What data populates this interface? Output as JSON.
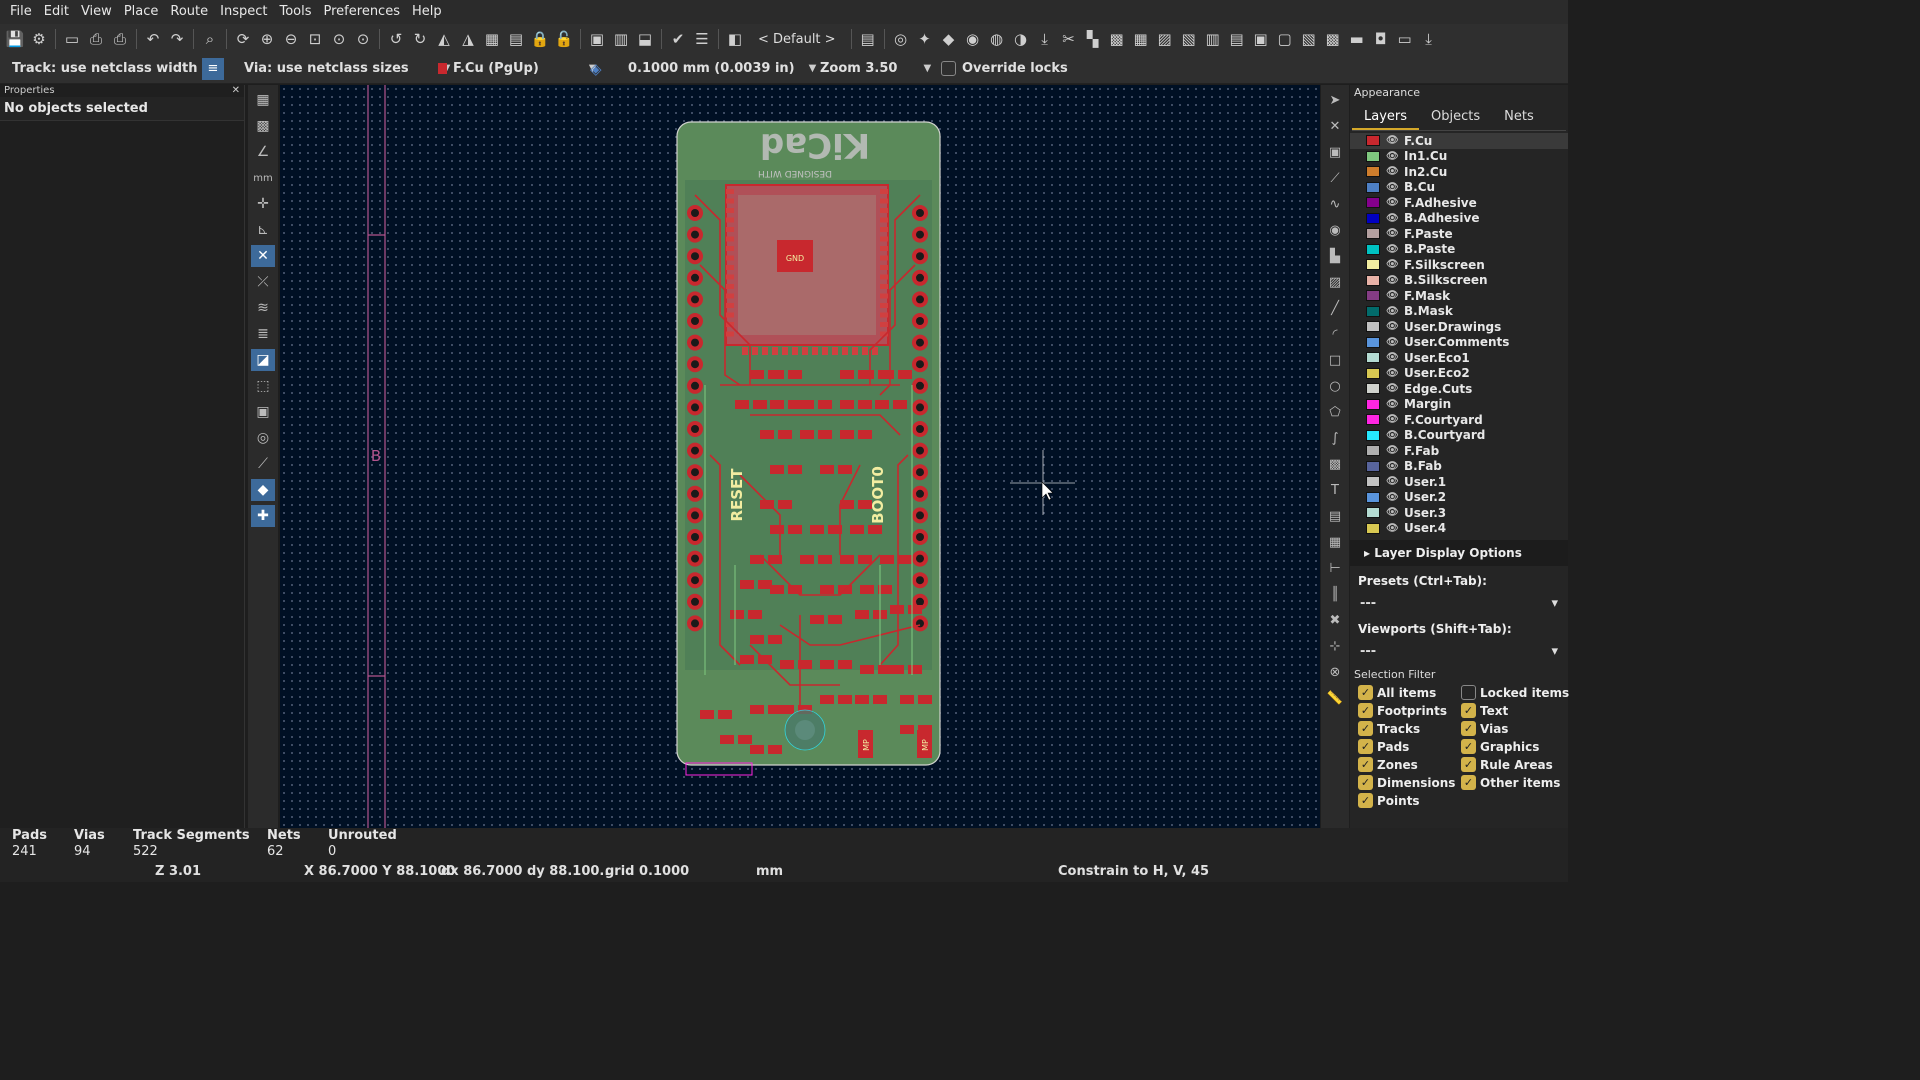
{
  "menu": [
    "File",
    "Edit",
    "View",
    "Place",
    "Route",
    "Inspect",
    "Tools",
    "Preferences",
    "Help"
  ],
  "toolbar": {
    "preset": "< Default >"
  },
  "options": {
    "track": "Track: use netclass width",
    "via": "Via: use netclass sizes",
    "layer": "F.Cu (PgUp)",
    "layer_color": "#c8282e",
    "grid": "0.1000 mm (0.0039 in)",
    "zoom": "Zoom 3.50",
    "override": "Override locks"
  },
  "properties": {
    "title": "Properties",
    "empty": "No objects selected"
  },
  "appearance": {
    "title": "Appearance",
    "tabs": [
      "Layers",
      "Objects",
      "Nets"
    ],
    "layers": [
      {
        "name": "F.Cu",
        "color": "#c8282e"
      },
      {
        "name": "In1.Cu",
        "color": "#7fc87f"
      },
      {
        "name": "In2.Cu",
        "color": "#ce7d2c"
      },
      {
        "name": "B.Cu",
        "color": "#4d7fc4"
      },
      {
        "name": "F.Adhesive",
        "color": "#84008c"
      },
      {
        "name": "B.Adhesive",
        "color": "#0000c0"
      },
      {
        "name": "F.Paste",
        "color": "#b4a0a0"
      },
      {
        "name": "B.Paste",
        "color": "#00c2c2"
      },
      {
        "name": "F.Silkscreen",
        "color": "#f2eda1"
      },
      {
        "name": "B.Silkscreen",
        "color": "#e8b2a7"
      },
      {
        "name": "F.Mask",
        "color": "#843c84"
      },
      {
        "name": "B.Mask",
        "color": "#026b6b"
      },
      {
        "name": "User.Drawings",
        "color": "#c2c2c2"
      },
      {
        "name": "User.Comments",
        "color": "#5994dc"
      },
      {
        "name": "User.Eco1",
        "color": "#b4dbd2"
      },
      {
        "name": "User.Eco2",
        "color": "#d8c852"
      },
      {
        "name": "Edge.Cuts",
        "color": "#d0d2cd"
      },
      {
        "name": "Margin",
        "color": "#ff26e2"
      },
      {
        "name": "F.Courtyard",
        "color": "#ff26e2"
      },
      {
        "name": "B.Courtyard",
        "color": "#26e9ff"
      },
      {
        "name": "F.Fab",
        "color": "#afafaf"
      },
      {
        "name": "B.Fab",
        "color": "#58649c"
      },
      {
        "name": "User.1",
        "color": "#c2c2c2"
      },
      {
        "name": "User.2",
        "color": "#5994dc"
      },
      {
        "name": "User.3",
        "color": "#b4dbd2"
      },
      {
        "name": "User.4",
        "color": "#d8c852"
      }
    ],
    "layer_display": "Layer Display Options",
    "presets_label": "Presets (Ctrl+Tab):",
    "presets_value": "---",
    "viewports_label": "Viewports (Shift+Tab):",
    "viewports_value": "---",
    "selection_filter": {
      "title": "Selection Filter",
      "items": [
        {
          "label": "All items",
          "checked": true
        },
        {
          "label": "Locked items",
          "checked": false
        },
        {
          "label": "Footprints",
          "checked": true
        },
        {
          "label": "Text",
          "checked": true
        },
        {
          "label": "Tracks",
          "checked": true
        },
        {
          "label": "Vias",
          "checked": true
        },
        {
          "label": "Pads",
          "checked": true
        },
        {
          "label": "Graphics",
          "checked": true
        },
        {
          "label": "Zones",
          "checked": true
        },
        {
          "label": "Rule Areas",
          "checked": true
        },
        {
          "label": "Dimensions",
          "checked": true
        },
        {
          "label": "Other items",
          "checked": true
        },
        {
          "label": "Points",
          "checked": true
        }
      ]
    }
  },
  "board": {
    "silk": {
      "logo": "KiCad",
      "designed": "DESIGNED WITH",
      "reset": "RESET",
      "boot": "BOOT0",
      "gnd": "GND",
      "mp": "MP"
    },
    "sheet_label": "B"
  },
  "stats": [
    {
      "label": "Pads",
      "value": "241"
    },
    {
      "label": "Vias",
      "value": "94"
    },
    {
      "label": "Track Segments",
      "value": "522"
    },
    {
      "label": "Nets",
      "value": "62"
    },
    {
      "label": "Unrouted",
      "value": "0"
    }
  ],
  "status": {
    "zoom": "Z 3.01",
    "xy": "X 86.7000  Y 88.1000",
    "dxy": "dx 86.7000  dy 88.100...",
    "grid": "grid 0.1000",
    "units": "mm",
    "constrain": "Constrain to H, V, 45"
  }
}
